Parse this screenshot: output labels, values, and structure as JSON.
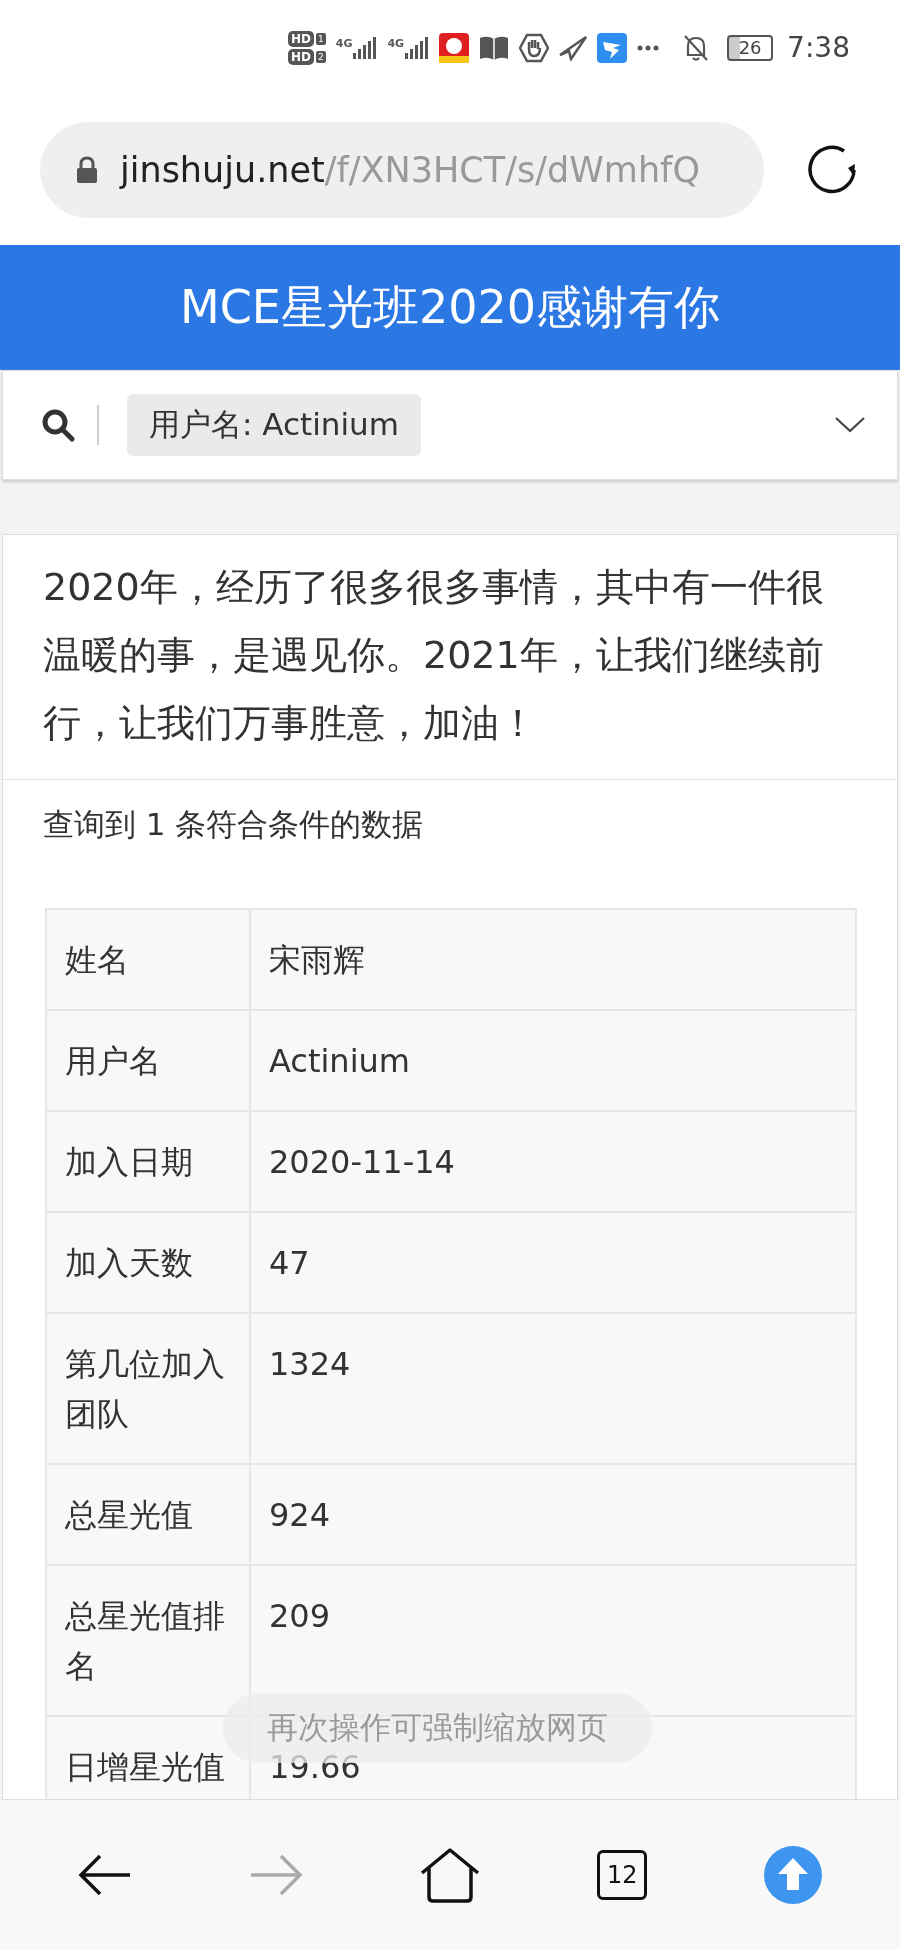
{
  "status_bar": {
    "sim": [
      {
        "badge": "HD",
        "slot": "1",
        "network": "4G"
      },
      {
        "badge": "HD",
        "slot": "2",
        "network": "4G"
      }
    ],
    "battery": "26",
    "time": "7:38"
  },
  "address_bar": {
    "domain": "jinshuju.net",
    "path": "/f/XN3HCT/s/dWmhfQ"
  },
  "header": {
    "title": "MCE星光班2020感谢有你"
  },
  "search": {
    "filter": "用户名: Actinium"
  },
  "intro": "2020年，经历了很多很多事情，其中有一件很温暖的事，是遇见你。2021年，让我们继续前行，让我们万事胜意，加油！",
  "result_count": "查询到 1 条符合条件的数据",
  "rows": [
    {
      "label": "姓名",
      "value": "宋雨辉"
    },
    {
      "label": "用户名",
      "value": "Actinium"
    },
    {
      "label": "加入日期",
      "value": "2020-11-14"
    },
    {
      "label": "加入天数",
      "value": "47"
    },
    {
      "label": "第几位加入团队",
      "value": "1324"
    },
    {
      "label": "总星光值",
      "value": "924"
    },
    {
      "label": "总星光值排名",
      "value": "209"
    },
    {
      "label": "日增星光值",
      "value": "19.66"
    }
  ],
  "toast": "再次操作可强制缩放网页",
  "bottom_nav": {
    "tab_count": "12",
    "forward_disabled": true
  }
}
